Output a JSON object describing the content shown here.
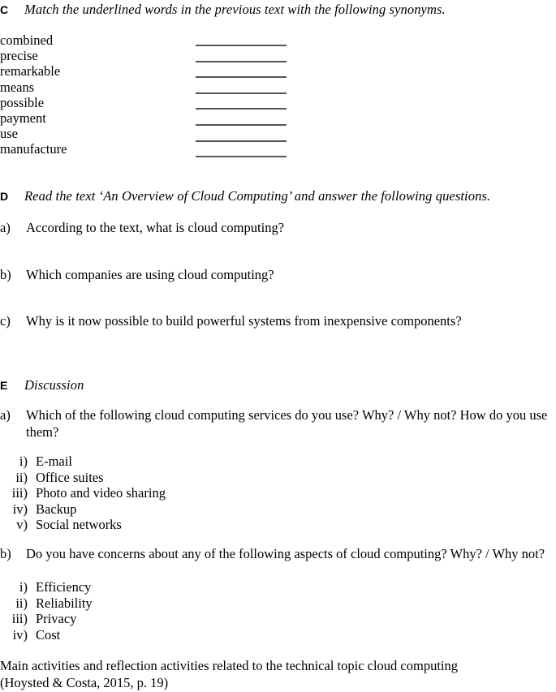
{
  "exercise_c": {
    "letter": "C",
    "instruction": "Match the underlined words in the previous text with the following synonyms.",
    "words": [
      "combined",
      "precise",
      "remarkable",
      "means",
      "possible",
      "payment",
      "use",
      "manufacture"
    ],
    "blank_count": 8
  },
  "exercise_d": {
    "letter": "D",
    "instruction": "Read the text ‘An Overview of  Cloud Computing’ and answer the following questions.",
    "questions": [
      {
        "label": "a)",
        "text": "According to the text, what is cloud computing?"
      },
      {
        "label": "b)",
        "text": "Which companies are using cloud computing?"
      },
      {
        "label": "c)",
        "text": "Why is it now possible to build powerful systems from inexpensive components?"
      }
    ]
  },
  "exercise_e": {
    "letter": "E",
    "instruction": "Discussion",
    "question_a": {
      "label": "a)",
      "text": "Which of the following cloud computing services do you use? Why? / Why not? How do you use them?",
      "items": [
        {
          "numeral": "i)",
          "label": "E-mail"
        },
        {
          "numeral": "ii)",
          "label": "Office suites"
        },
        {
          "numeral": "iii)",
          "label": "Photo and video sharing"
        },
        {
          "numeral": "iv)",
          "label": "Backup"
        },
        {
          "numeral": "v)",
          "label": "Social networks"
        }
      ]
    },
    "question_b": {
      "label": "b)",
      "text": "Do you have concerns about any of the following aspects of  cloud computing? Why? / Why not?",
      "items": [
        {
          "numeral": "i)",
          "label": "Efficiency"
        },
        {
          "numeral": "ii)",
          "label": "Reliability"
        },
        {
          "numeral": "iii)",
          "label": "Privacy"
        },
        {
          "numeral": "iv)",
          "label": "Cost"
        }
      ]
    }
  },
  "caption": {
    "line1": "Main activities and reflection activities related to the technical topic cloud computing",
    "line2": "(Hoysted & Costa, 2015, p. 19)"
  },
  "colors": {
    "text": "#000000",
    "blank_line": "#555555",
    "background": "#ffffff"
  }
}
